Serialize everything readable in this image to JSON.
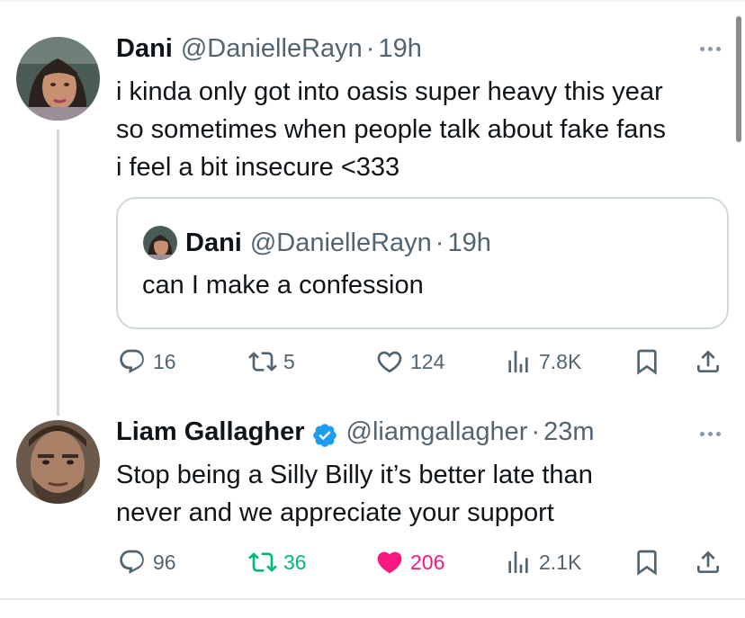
{
  "thread": {
    "reply_tweet": {
      "author_name": "Dani",
      "handle": "@DanielleRayn",
      "time": "19h",
      "text_lines": [
        "i kinda only got into oasis super heavy this year",
        "so sometimes when people talk about fake fans",
        "i feel a bit insecure <333"
      ],
      "quoted": {
        "author_name": "Dani",
        "handle": "@DanielleRayn",
        "time": "19h",
        "text": "can I make a confession"
      },
      "stats": {
        "replies": "16",
        "retweets": "5",
        "likes": "124",
        "views": "7.8K"
      }
    },
    "main_tweet": {
      "author_name": "Liam Gallagher",
      "verified": true,
      "handle": "@liamgallagher",
      "time": "23m",
      "text_lines": [
        "Stop being a Silly Billy it’s better late than",
        "never and we appreciate your support"
      ],
      "stats": {
        "replies": "96",
        "retweets": "36",
        "likes": "206",
        "views": "2.1K"
      },
      "retweeted": true,
      "liked": true
    }
  },
  "separator": "·",
  "colors": {
    "text_primary": "#0f1419",
    "text_secondary": "#536471",
    "verified_blue": "#1d9bf0",
    "retweet_green": "#00ba7c",
    "like_pink": "#f91880",
    "border": "#cfd9de"
  },
  "icons": [
    "reply-icon",
    "retweet-icon",
    "like-icon",
    "views-icon",
    "bookmark-icon",
    "share-icon",
    "more-icon",
    "verified-badge-icon"
  ]
}
